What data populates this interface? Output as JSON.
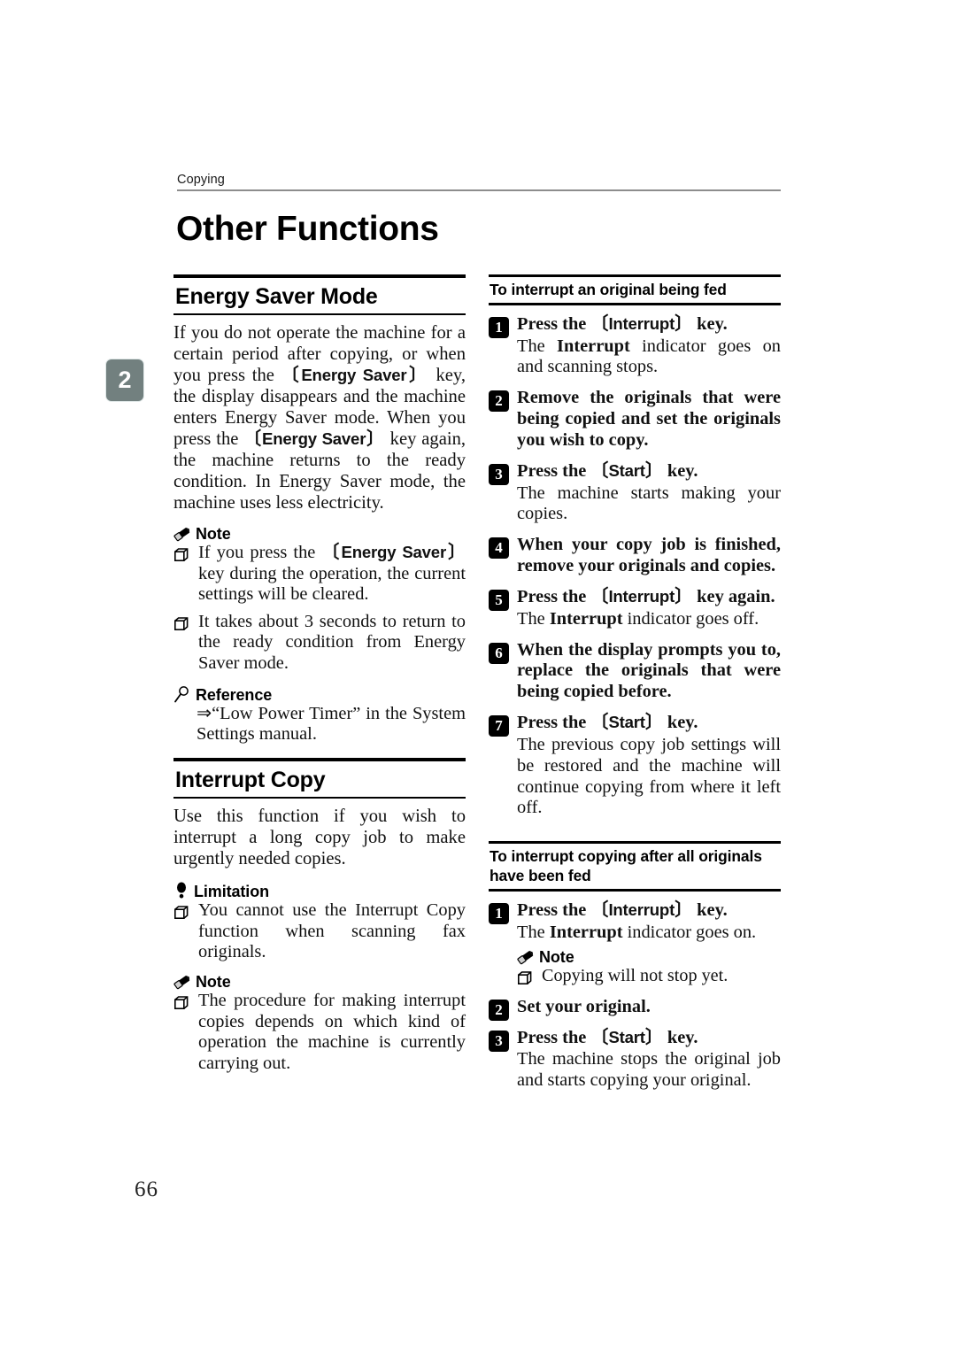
{
  "header": {
    "running_head": "Copying",
    "page_number": "66",
    "chapter_tab": "2"
  },
  "title": "Other Functions",
  "left_column": {
    "section1": {
      "heading": "Energy Saver Mode",
      "paragraph": "If you do not operate the machine for a certain period after copying, or when you press the [Energy Saver] key, the display disappears and the machine enters Energy Saver mode. When you press the [Energy Saver] key again, the machine returns to the ready condition. In Energy Saver mode, the machine uses less electricity.",
      "paragraph_parts": {
        "p1": "If you do not operate the machine for a certain period after copying, or when you press the ",
        "key1": "Energy Saver",
        "p2": " key, the display disappears and the machine enters Energy Saver mode. When you press the ",
        "key2": "Energy Saver",
        "p3": " key again, the machine returns to the ready condition. In Energy Saver mode, the machine uses less electricity."
      },
      "note": {
        "label": "Note",
        "icon": "pencil-icon",
        "items_parts": {
          "i1a": "If you press the ",
          "i1key": "Energy Saver",
          "i1b": " key during the operation, the current settings will be cleared.",
          "i2": "It takes about 3 seconds to return to the ready condition from Energy Saver mode."
        }
      },
      "reference": {
        "label": "Reference",
        "icon": "magnifier-icon",
        "text": "⇒“Low Power Timer” in the System Settings manual."
      }
    },
    "section2": {
      "heading": "Interrupt Copy",
      "paragraph": "Use this function if you wish to interrupt a long copy job to make urgently needed copies.",
      "limitation": {
        "label": "Limitation",
        "icon": "balloon-icon",
        "items": [
          "You cannot use the Interrupt Copy function when scanning fax originals."
        ]
      },
      "note": {
        "label": "Note",
        "icon": "pencil-icon",
        "items": [
          "The procedure for making interrupt copies depends on which kind of operation the machine is currently carrying out."
        ]
      }
    }
  },
  "right_column": {
    "subsection1": {
      "heading": "To interrupt an original being fed",
      "steps": [
        {
          "num": "1",
          "title_parts": {
            "a": "Press the ",
            "key": "Interrupt",
            "b": " key."
          },
          "body_parts": {
            "a": "The ",
            "b": "Interrupt",
            "c": " indicator goes on and scanning stops."
          }
        },
        {
          "num": "2",
          "title": "Remove the originals that were being copied and set the originals you wish to copy.",
          "body": ""
        },
        {
          "num": "3",
          "title_parts": {
            "a": "Press the ",
            "key": "Start",
            "b": " key."
          },
          "body": "The machine starts making your copies."
        },
        {
          "num": "4",
          "title": "When your copy job is finished, remove your originals and copies.",
          "body": ""
        },
        {
          "num": "5",
          "title_parts": {
            "a": "Press the ",
            "key": "Interrupt",
            "b": " key again."
          },
          "body_parts": {
            "a": "The ",
            "b": "Interrupt",
            "c": " indicator goes off."
          }
        },
        {
          "num": "6",
          "title": "When the display prompts you to, replace the originals that were being copied before.",
          "body": ""
        },
        {
          "num": "7",
          "title_parts": {
            "a": "Press the ",
            "key": "Start",
            "b": " key."
          },
          "body": "The previous copy job settings will be restored and the machine will continue copying from where it left off."
        }
      ]
    },
    "subsection2": {
      "heading": "To interrupt copying after all originals have been fed",
      "steps": [
        {
          "num": "1",
          "title_parts": {
            "a": "Press the ",
            "key": "Interrupt",
            "b": " key."
          },
          "body_parts": {
            "a": "The ",
            "b": "Interrupt",
            "c": " indicator goes on."
          },
          "note": {
            "label": "Note",
            "icon": "pencil-icon",
            "items": [
              "Copying will not stop yet."
            ]
          }
        },
        {
          "num": "2",
          "title": "Set your original.",
          "body": ""
        },
        {
          "num": "3",
          "title_parts": {
            "a": "Press the ",
            "key": "Start",
            "b": " key."
          },
          "body": "The machine stops the original job and starts copying your original."
        }
      ]
    }
  },
  "colors": {
    "chapter_tab_bg": "#72807f",
    "rule": "#000000",
    "header_rule": "#8d8d8d",
    "text": "#111111"
  }
}
